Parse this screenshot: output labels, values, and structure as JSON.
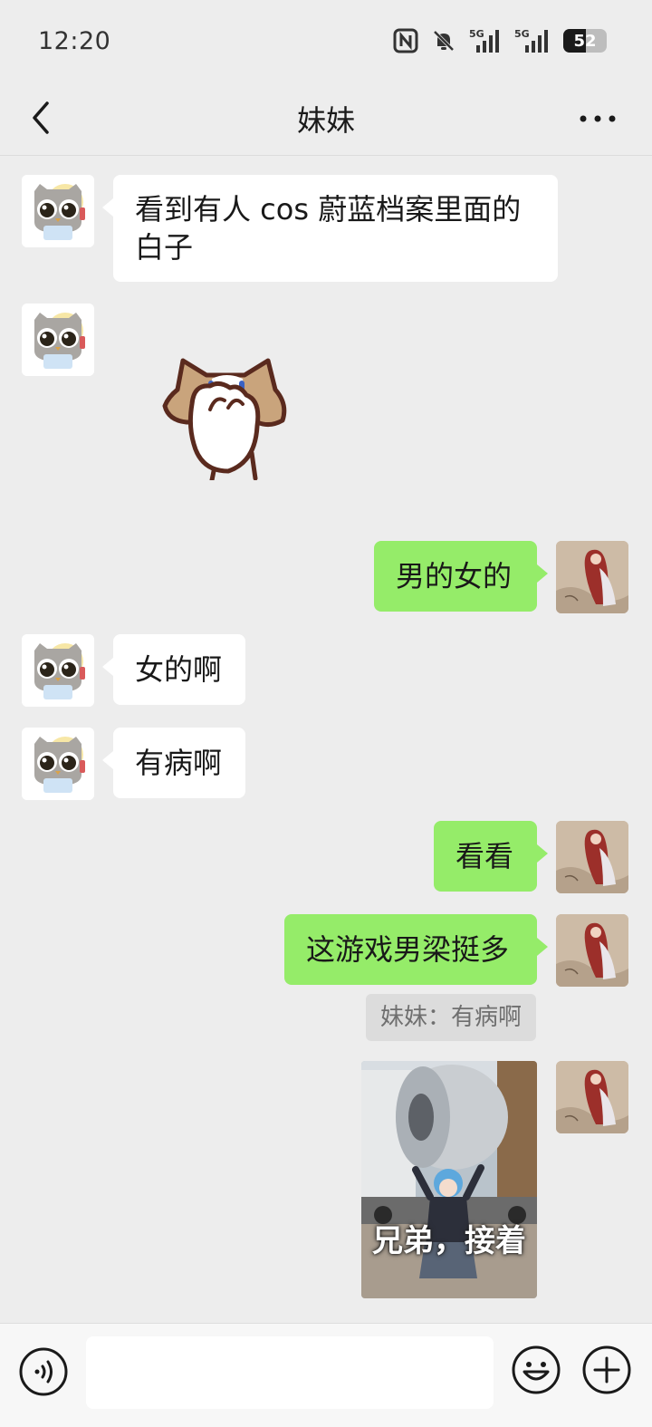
{
  "status_bar": {
    "time": "12:20",
    "icons": [
      "nfc-icon",
      "bell-muted-icon",
      "signal-5g-icon",
      "signal-5g-icon"
    ],
    "signal_labels": [
      "5G",
      "5G"
    ],
    "battery_level": "52"
  },
  "header": {
    "title": "妹妹",
    "back_icon": "chevron-left-icon",
    "more_icon": "more-horizontal-icon"
  },
  "messages": [
    {
      "direction": "in",
      "type": "text",
      "text": "看到有人 cos 蔚蓝档案里面的白子"
    },
    {
      "direction": "in",
      "type": "sticker",
      "sticker": "cat-covering-face"
    },
    {
      "direction": "out",
      "type": "text",
      "text": "男的女的"
    },
    {
      "direction": "in",
      "type": "text",
      "text": "女的啊"
    },
    {
      "direction": "in",
      "type": "text",
      "text": "有病啊"
    },
    {
      "direction": "out",
      "type": "text",
      "text": "看看"
    },
    {
      "direction": "out",
      "type": "text",
      "text": "这游戏男梁挺多",
      "quote": "妹妹：有病啊"
    },
    {
      "direction": "out",
      "type": "image",
      "caption": "兄弟，接着"
    }
  ],
  "input_bar": {
    "placeholder": "",
    "value": "",
    "voice_icon": "voice-icon",
    "emoji_icon": "emoji-icon",
    "plus_icon": "plus-circle-icon"
  },
  "colors": {
    "background": "#ededed",
    "outgoing_bubble": "#95ec69",
    "incoming_bubble": "#ffffff",
    "quote_background": "#dcdcdc"
  }
}
